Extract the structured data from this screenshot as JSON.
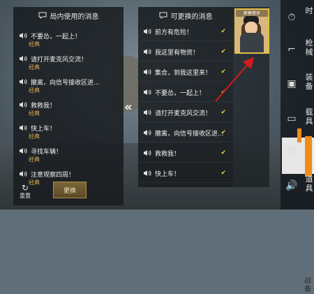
{
  "panels": {
    "left": {
      "title": "局内使用的消息",
      "items": [
        {
          "text": "不要怂，一起上！",
          "tag": "经典"
        },
        {
          "text": "请打开麦克风交流！",
          "tag": "经典"
        },
        {
          "text": "撤离，向信号接收区进...",
          "tag": "经典"
        },
        {
          "text": "救救我！",
          "tag": "经典"
        },
        {
          "text": "快上车！",
          "tag": "经典"
        },
        {
          "text": "寻找车辆！",
          "tag": "经典"
        },
        {
          "text": "注意观察四周！",
          "tag": "经典"
        }
      ],
      "reset": "重置",
      "change": "更换"
    },
    "middle": {
      "title": "可更换的消息",
      "items": [
        {
          "text": "前方有危险！"
        },
        {
          "text": "我这里有物资！"
        },
        {
          "text": "集合，到我这里来！"
        },
        {
          "text": "不要怂，一起上！"
        },
        {
          "text": "请打开麦克风交流！"
        },
        {
          "text": "撤离，向信号接收区进..."
        },
        {
          "text": "救救我！"
        },
        {
          "text": "快上车！"
        }
      ]
    },
    "portrait": {
      "label": "新春贺岁"
    }
  },
  "sidebar": {
    "items": [
      {
        "label": "时",
        "icon": "clock-icon"
      },
      {
        "label": "枪械",
        "icon": "gun-icon"
      },
      {
        "label": "装备",
        "icon": "backpack-icon"
      },
      {
        "label": "载具",
        "icon": "car-icon"
      },
      {
        "label": "战备",
        "icon": "image-icon"
      },
      {
        "label": "道具",
        "icon": "speaker-icon"
      }
    ],
    "selected": "战备"
  },
  "colors": {
    "accent": "#f08b18",
    "text_gold": "#d8a64a",
    "check_yellow": "#f1d34a",
    "panel_bg": "#181c1f"
  },
  "nav": {
    "pager_glyph": "«"
  }
}
